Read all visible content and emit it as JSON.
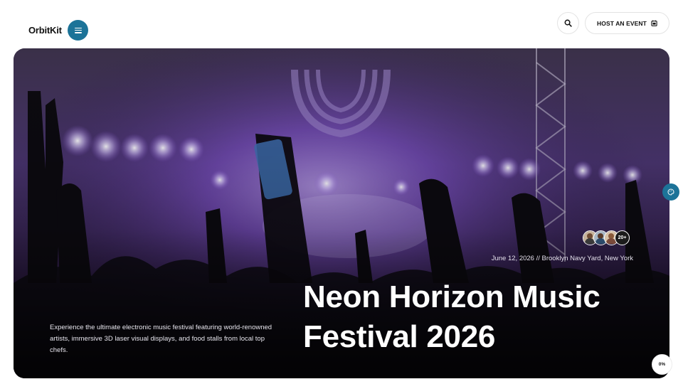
{
  "header": {
    "logo": "OrbitKit",
    "menu_icon": "hamburger-icon",
    "search_icon": "search-icon",
    "host_button_label": "HOST AN EVENT",
    "host_button_icon": "calendar-icon"
  },
  "hero": {
    "description": "Experience the ultimate electronic music festival featuring world-renowned artists, immersive 3D laser visual displays, and food stalls from local top chefs.",
    "title_line1": "Neon Horizon Music",
    "title_line2": "Festival 2026",
    "meta": "June 12, 2026 // Brooklyn Navy Yard, New York",
    "attendees_more": "20+",
    "background_icon": "concert-crowd-image"
  },
  "widgets": {
    "side_icon": "palette-icon",
    "scroll_progress": "0%"
  },
  "colors": {
    "accent": "#1c7398",
    "hero_purple": "#6b3fb0"
  }
}
